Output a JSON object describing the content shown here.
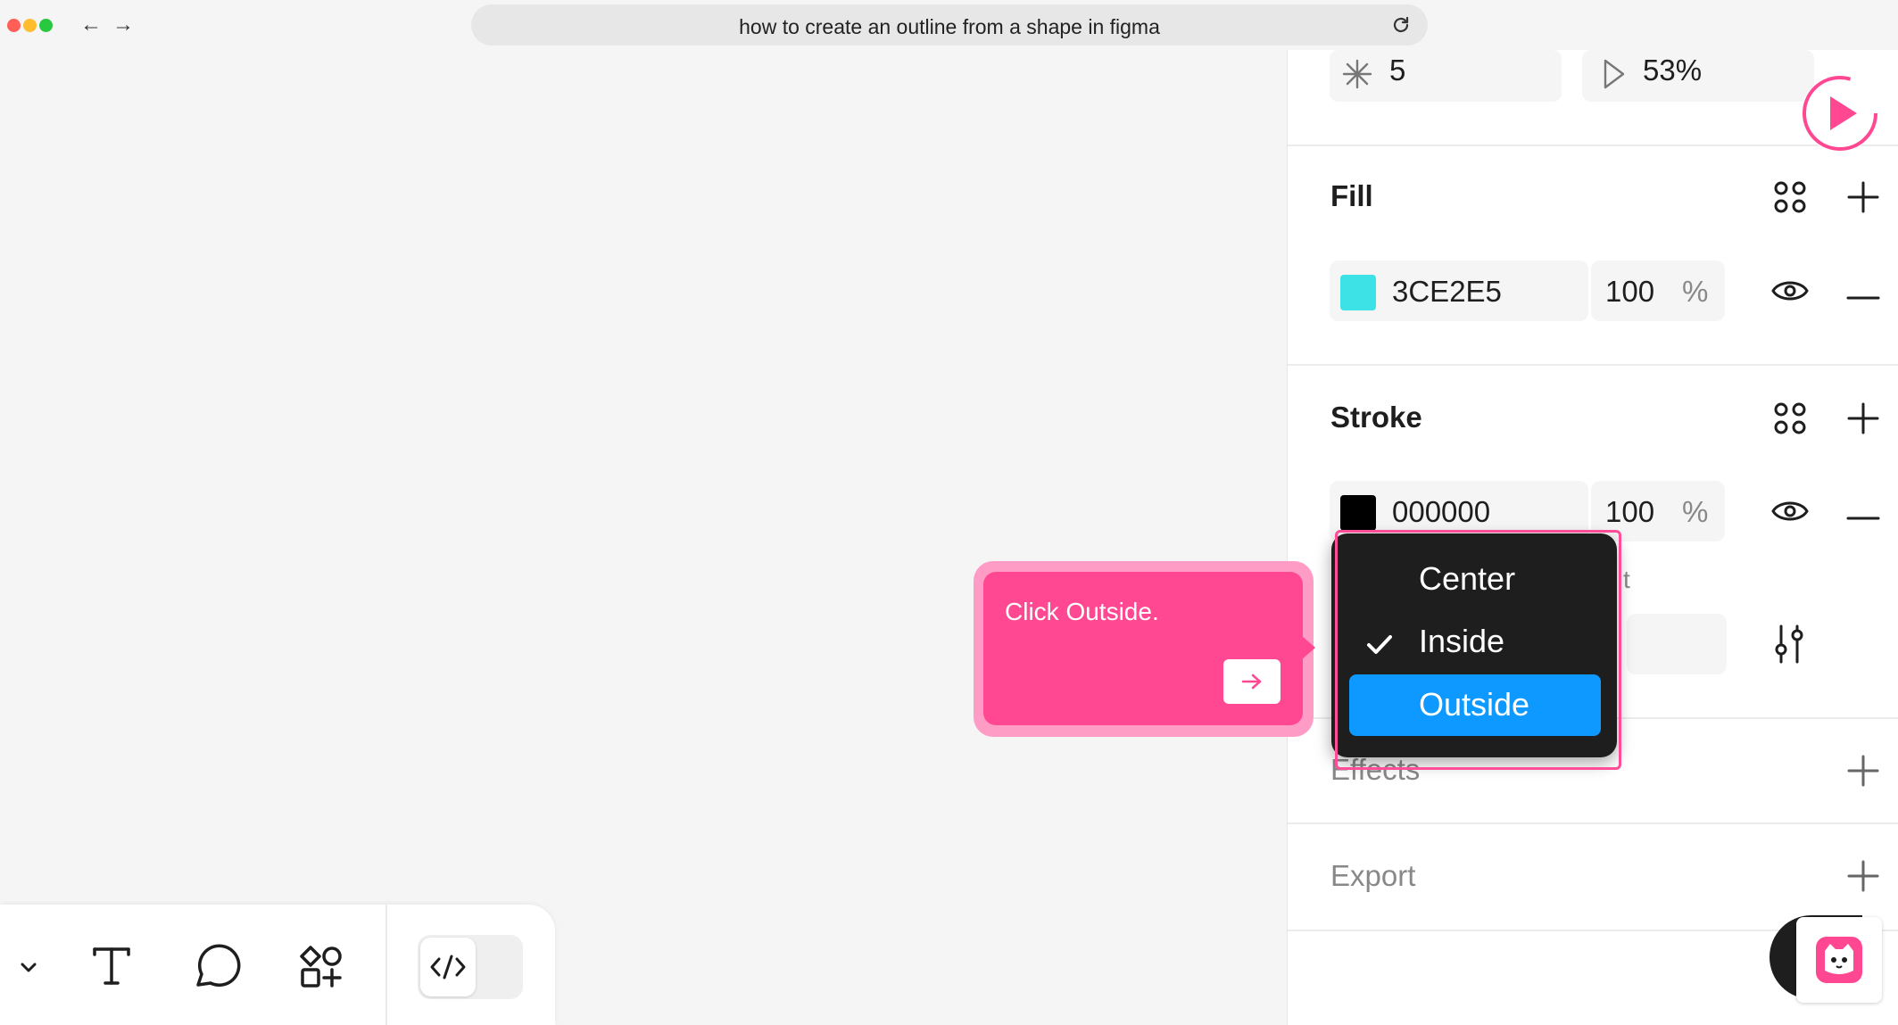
{
  "browser": {
    "url": "how to create an outline from a shape in figma"
  },
  "panel": {
    "top_row": {
      "count": "5",
      "ratio": "53%"
    },
    "fill": {
      "title": "Fill",
      "color_hex": "3CE2E5",
      "swatch": "#3CE2E5",
      "opacity": "100",
      "unit": "%"
    },
    "stroke": {
      "title": "Stroke",
      "color_hex": "000000",
      "swatch": "#000000",
      "opacity": "100",
      "unit": "%",
      "partial_label": "t"
    },
    "effects": {
      "title": "Effects"
    },
    "export": {
      "title": "Export"
    }
  },
  "dropdown": {
    "options": [
      "Center",
      "Inside",
      "Outside"
    ],
    "checked": "Inside",
    "highlighted": "Outside"
  },
  "tooltip": {
    "text": "Click Outside."
  },
  "colors": {
    "accent_pink": "#ff4891",
    "highlight_blue": "#0d99ff",
    "panel_bg": "#ffffff"
  }
}
